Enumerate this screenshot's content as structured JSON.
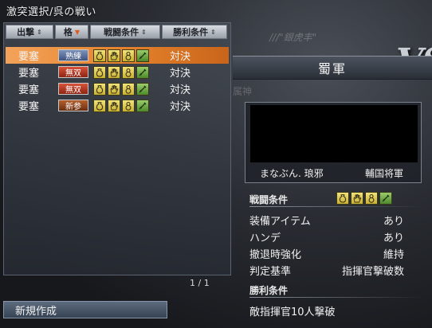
{
  "window": {
    "title": "激突選択/呉の戦い"
  },
  "list": {
    "headers": {
      "deploy": "出撃",
      "rank": "格",
      "battle": "戦闘条件",
      "victory": "勝利条件"
    },
    "rows": [
      {
        "deploy": "要塞",
        "rank": "熟練",
        "rank_color": "blue",
        "battle_icons": [
          "pouch-icon",
          "hand-icon",
          "gourd-icon",
          "sword-icon"
        ],
        "victory": "対決",
        "selected": true
      },
      {
        "deploy": "要塞",
        "rank": "無双",
        "rank_color": "red",
        "battle_icons": [
          "pouch-icon",
          "hand-icon",
          "gourd-icon",
          "sword-icon"
        ],
        "victory": "対決",
        "selected": false
      },
      {
        "deploy": "要塞",
        "rank": "無双",
        "rank_color": "red",
        "battle_icons": [
          "pouch-icon",
          "hand-icon",
          "gourd-icon",
          "sword-icon"
        ],
        "victory": "対決",
        "selected": false
      },
      {
        "deploy": "要塞",
        "rank": "新参",
        "rank_color": "brown",
        "battle_icons": [
          "pouch-icon",
          "hand-icon",
          "gourd-icon",
          "sword-icon"
        ],
        "victory": "対決",
        "selected": false
      }
    ],
    "page": "1 / 1"
  },
  "new_button": {
    "label": "新規作成"
  },
  "background": {
    "logo": "VS",
    "deco": "///\"銀虎丰\"",
    "deco2": "属神"
  },
  "detail": {
    "army": "蜀軍",
    "player_name": "まなぶん. 琅邪",
    "player_role": "輔国将軍",
    "battle_section_title": "戦闘条件",
    "battle_icons": [
      "pouch-icon",
      "hand-icon",
      "gourd-icon",
      "sword-icon"
    ],
    "conditions": [
      {
        "label": "装備アイテム",
        "value": "あり"
      },
      {
        "label": "ハンデ",
        "value": "あり"
      },
      {
        "label": "撤退時強化",
        "value": "維持"
      },
      {
        "label": "判定基準",
        "value": "指揮官撃破数"
      }
    ],
    "victory_section_title": "勝利条件",
    "victory_condition": "敵指揮官10人撃破"
  },
  "colors": {
    "selected_row": "#e7842e",
    "rank_blue": "#3e5380",
    "rank_red": "#8c2412",
    "rank_brown": "#6a2f10",
    "icon_yellow": "#e6d25a",
    "icon_green": "#6fa843"
  }
}
